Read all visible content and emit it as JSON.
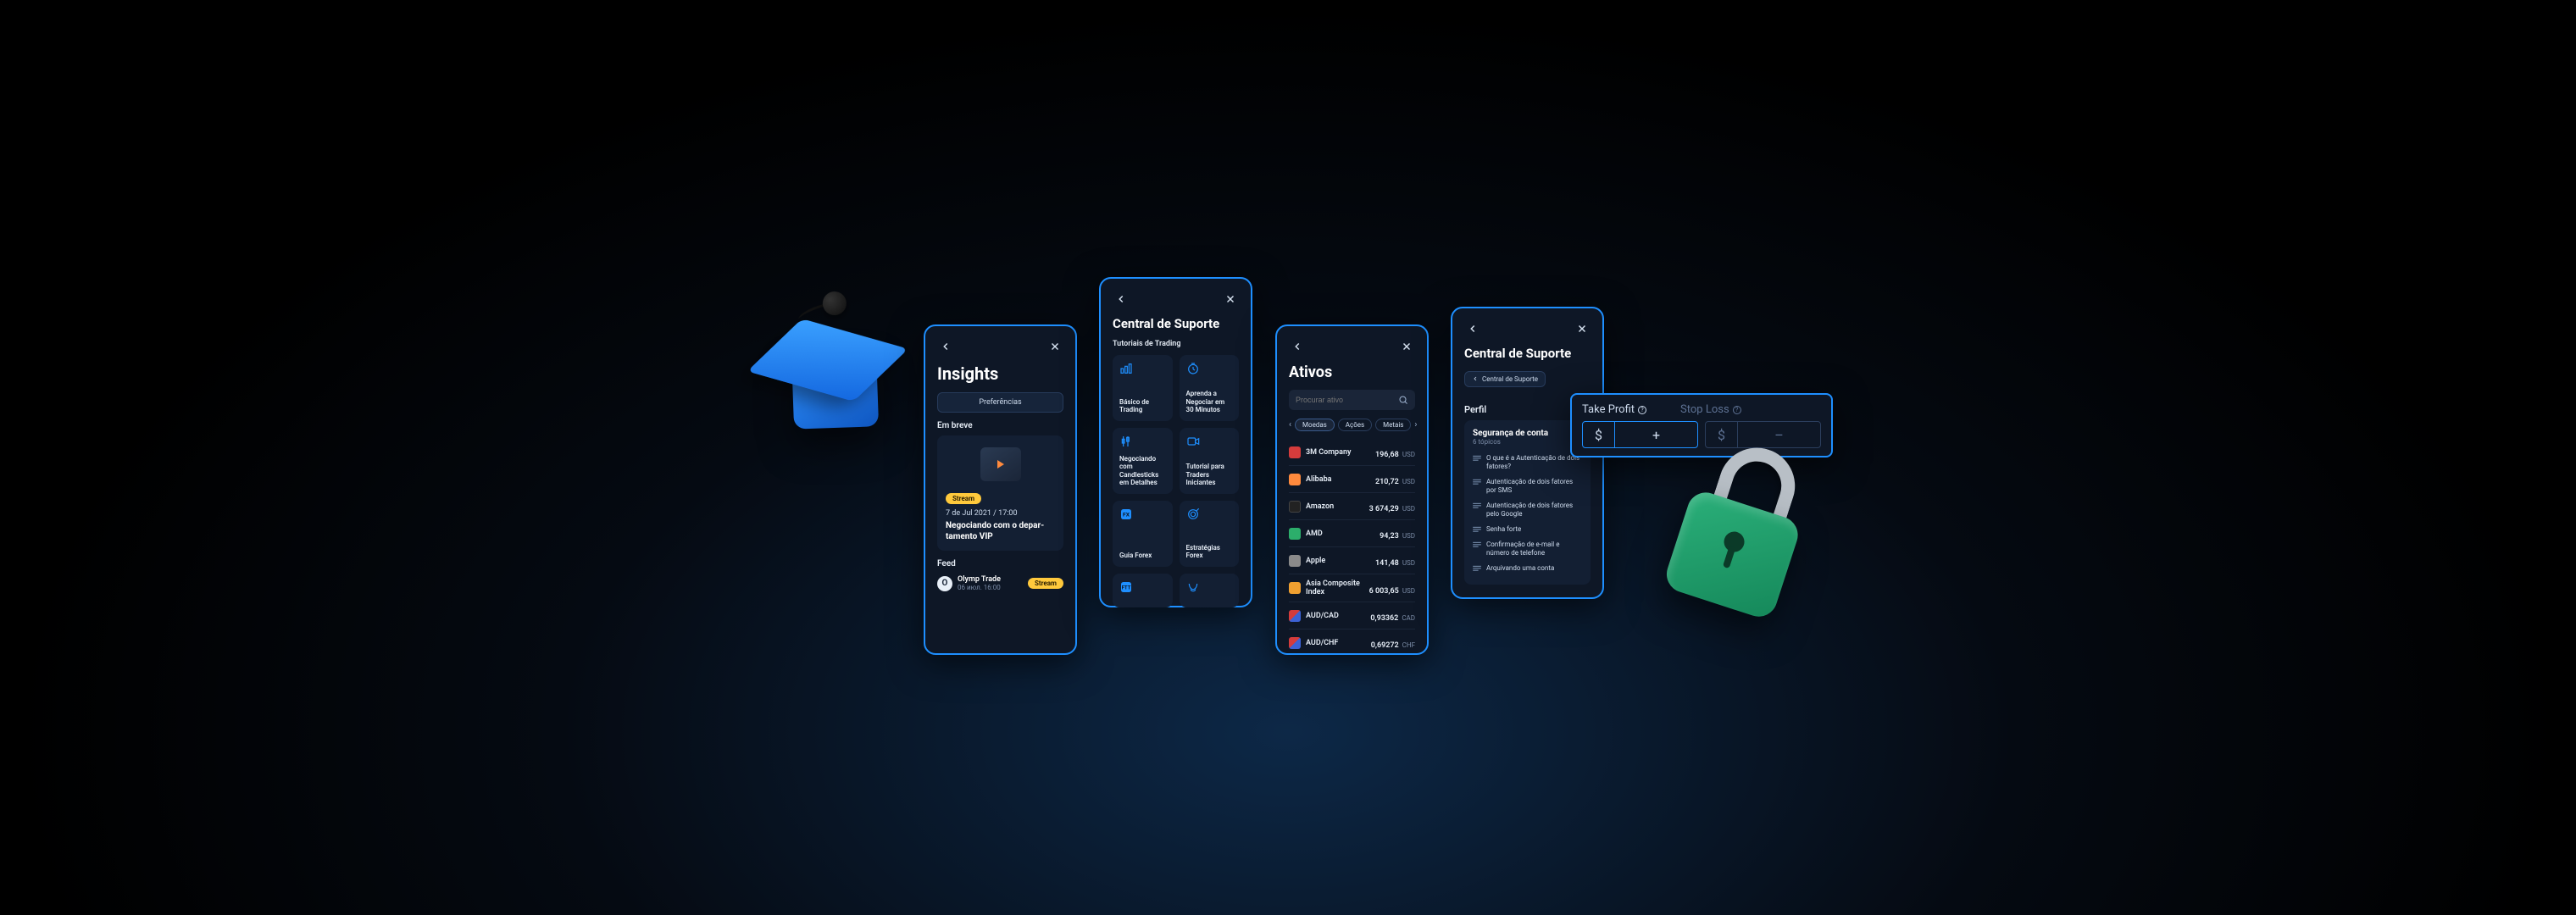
{
  "insights": {
    "title": "Insights",
    "prefs": "Preferências",
    "soon": "Em breve",
    "stream_chip": "Stream",
    "card_date": "7 de Jul 2021 / 17:00",
    "card_title": "Negociando com o depar-\ntamento VIP",
    "feed": "Feed",
    "feed_name": "Olymp Trade",
    "feed_sub": "06 июл. 16:00",
    "feed_chip": "Stream"
  },
  "support1": {
    "title": "Central de Suporte",
    "sub": "Tutoriais de Trading",
    "tiles": [
      "Básico de Trading",
      "Aprenda a Negociar em 30 Minutos",
      "Negociando com Candlesticks em Detalhes",
      "Tutorial para Traders Iniciantes",
      "Guia Forex",
      "Estratégias Forex",
      "",
      ""
    ]
  },
  "assets": {
    "title": "Ativos",
    "search_placeholder": "Procurar ativo",
    "tabs": {
      "t1": "Moedas",
      "t2": "Ações",
      "t3": "Metais"
    },
    "rows": [
      {
        "name": "3M Company",
        "price": "196,68",
        "cur": "USD",
        "flag": "red"
      },
      {
        "name": "Alibaba",
        "price": "210,72",
        "cur": "USD",
        "flag": "orange"
      },
      {
        "name": "Amazon",
        "price": "3 674,29",
        "cur": "USD",
        "flag": "black"
      },
      {
        "name": "AMD",
        "price": "94,23",
        "cur": "USD",
        "flag": "green"
      },
      {
        "name": "Apple",
        "price": "141,48",
        "cur": "USD",
        "flag": "grey"
      },
      {
        "name": "Asia Composite Index",
        "price": "6 003,65",
        "cur": "USD",
        "flag": "orange2"
      },
      {
        "name": "AUD/CAD",
        "price": "0,93362",
        "cur": "CAD",
        "flag": "pair"
      },
      {
        "name": "AUD/CHF",
        "price": "0,69272",
        "cur": "CHF",
        "flag": "pair"
      }
    ]
  },
  "support2": {
    "title": "Central de Suporte",
    "crumb": "Central de Suporte",
    "profile": "Perfil",
    "sec_title": "Segurança de conta",
    "sec_sub": "6 tópicos",
    "topics": [
      "O que é a Autenticação de dois fatores?",
      "Autenticação de dois fatores por SMS",
      "Autenticação de dois fatores pelo Google",
      "Senha forte",
      "Confirmação de e-mail e número de telefone",
      "Arquivando uma conta"
    ]
  },
  "tpsl": {
    "tp": "Take Profit",
    "sl": "Stop Loss",
    "sym": "$",
    "plus": "+",
    "minus": "–"
  }
}
